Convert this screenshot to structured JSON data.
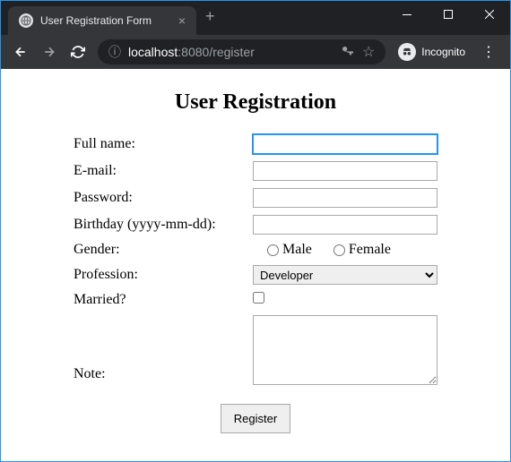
{
  "browser": {
    "tab_title": "User Registration Form",
    "url_host": "localhost",
    "url_port": ":8080",
    "url_path": "/register",
    "incognito_label": "Incognito"
  },
  "page": {
    "heading": "User Registration",
    "labels": {
      "fullname": "Full name:",
      "email": "E-mail:",
      "password": "Password:",
      "birthday": "Birthday (yyyy-mm-dd):",
      "gender": "Gender:",
      "profession": "Profession:",
      "married": "Married?",
      "note": "Note:"
    },
    "gender_options": {
      "male": "Male",
      "female": "Female"
    },
    "profession_selected": "Developer",
    "submit_label": "Register",
    "values": {
      "fullname": "",
      "email": "",
      "password": "",
      "birthday": "",
      "note": ""
    }
  }
}
